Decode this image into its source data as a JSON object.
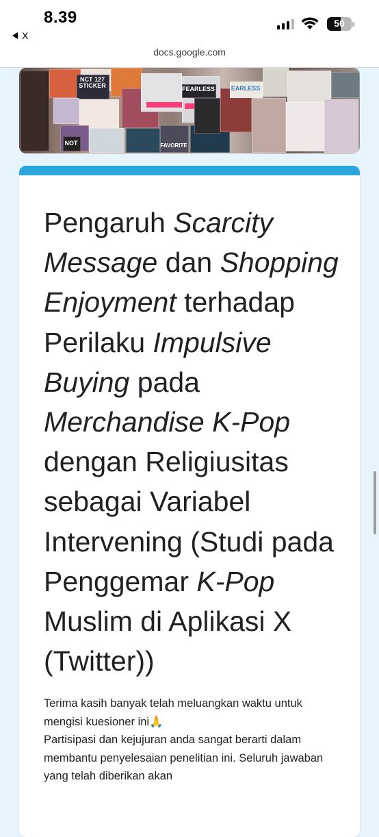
{
  "status_bar": {
    "time": "8.39",
    "back_app_label": "X",
    "battery_level": "50",
    "signal_bars_on": 3,
    "signal_bars_total": 4
  },
  "browser": {
    "url": "docs.google.com"
  },
  "banner": {
    "labels": [
      "NCT 127 STICKER",
      "FEARLESS",
      "EARLESS",
      "FAVORITE",
      "NOT"
    ]
  },
  "form": {
    "title_parts": [
      {
        "text": "Pengaruh ",
        "italic": false
      },
      {
        "text": "Scarcity Message",
        "italic": true
      },
      {
        "text": " dan ",
        "italic": false
      },
      {
        "text": "Shopping Enjoyment",
        "italic": true
      },
      {
        "text": " terhadap Perilaku ",
        "italic": false
      },
      {
        "text": "Impulsive Buying",
        "italic": true
      },
      {
        "text": " pada ",
        "italic": false
      },
      {
        "text": "Merchandise K-Pop",
        "italic": true
      },
      {
        "text": " dengan Religiusitas sebagai Variabel Intervening (Studi pada Penggemar ",
        "italic": false
      },
      {
        "text": "K-Pop",
        "italic": true
      },
      {
        "text": " Muslim di Aplikasi X (Twitter))",
        "italic": false
      }
    ],
    "description_lines": [
      "Terima kasih banyak telah meluangkan waktu untuk mengisi kuesioner ini🙏",
      "Partisipasi dan kejujuran anda sangat berarti dalam membantu penyelesaian penelitian ini. Seluruh jawaban yang telah diberikan akan"
    ]
  },
  "colors": {
    "accent": "#2aa6dd",
    "page_background": "#e8f4fb"
  }
}
